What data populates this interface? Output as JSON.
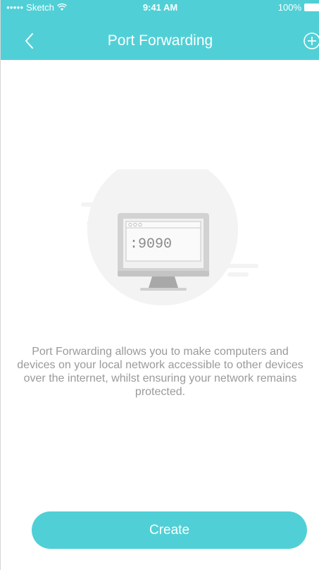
{
  "status_bar": {
    "signal": "●●●●●",
    "carrier": "Sketch",
    "time": "9:41 AM",
    "battery": "100%"
  },
  "nav": {
    "title": "Port Forwarding",
    "back_icon": "chevron-left-icon",
    "add_icon": "plus-circle-icon"
  },
  "illustration": {
    "port_text": ":9090"
  },
  "description": "Port Forwarding allows you to make computers and devices on your local network accessible to other devices over the internet, whilst ensuring your network remains protected.",
  "create_button": {
    "label": "Create"
  },
  "colors": {
    "accent": "#50d0d6",
    "text_muted": "#9a9a9a"
  }
}
